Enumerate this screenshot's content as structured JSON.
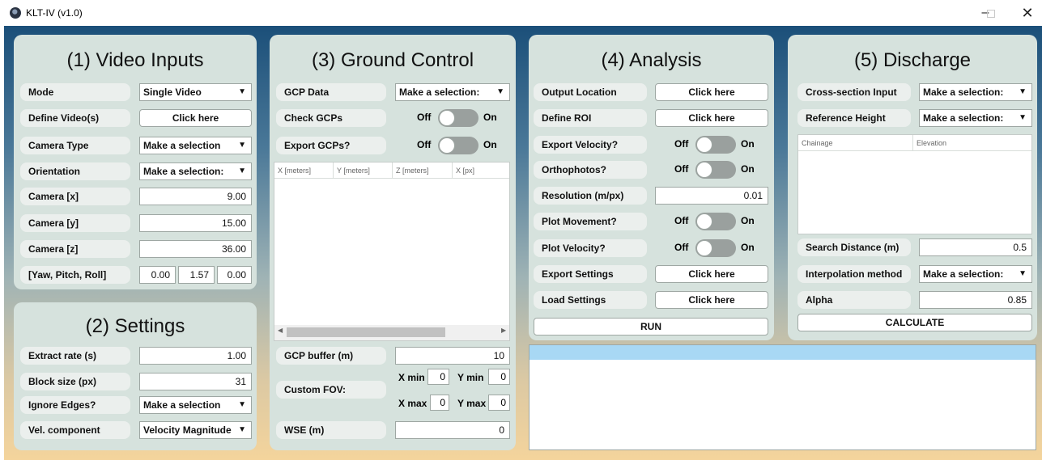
{
  "window": {
    "title": "KLT-IV (v1.0)",
    "min_glyph": "–",
    "close_glyph": "✕"
  },
  "colors": {
    "panel": "#d6e2dd",
    "label_bg": "#ebefed",
    "log_header": "#a8d8f4"
  },
  "video": {
    "title": "(1) Video Inputs",
    "mode_label": "Mode",
    "mode_value": "Single Video",
    "define_label": "Define Video(s)",
    "define_button": "Click here",
    "camera_type_label": "Camera Type",
    "camera_type_value": "Make a selection",
    "orientation_label": "Orientation",
    "orientation_value": "Make a selection:",
    "cam_x_label": "Camera [x]",
    "cam_x_value": "9.00",
    "cam_y_label": "Camera [y]",
    "cam_y_value": "15.00",
    "cam_z_label": "Camera [z]",
    "cam_z_value": "36.00",
    "ypr_label": "[Yaw, Pitch, Roll]",
    "yaw": "0.00",
    "pitch": "1.57",
    "roll": "0.00"
  },
  "settings": {
    "title": "(2) Settings",
    "extract_label": "Extract rate (s)",
    "extract_value": "1.00",
    "block_label": "Block size (px)",
    "block_value": "31",
    "edges_label": "Ignore Edges?",
    "edges_value": "Make a selection",
    "vel_label": "Vel. component",
    "vel_value": "Velocity Magnitude"
  },
  "ground": {
    "title": "(3) Ground Control",
    "gcp_label": "GCP Data",
    "gcp_value": "Make a selection:",
    "check_label": "Check GCPs",
    "export_label": "Export GCPs?",
    "table_cols": [
      "X [meters]",
      "Y [meters]",
      "Z [meters]",
      "X [px]"
    ],
    "buffer_label": "GCP buffer (m)",
    "buffer_value": "10",
    "fov_label": "Custom FOV:",
    "xmin_label": "X min",
    "xmin_value": "0",
    "ymin_label": "Y min",
    "ymin_value": "0",
    "xmax_label": "X max",
    "xmax_value": "0",
    "ymax_label": "Y max",
    "ymax_value": "0",
    "wse_label": "WSE (m)",
    "wse_value": "0"
  },
  "toggle": {
    "off": "Off",
    "on": "On"
  },
  "analysis": {
    "title": "(4) Analysis",
    "output_label": "Output Location",
    "output_button": "Click here",
    "roi_label": "Define ROI",
    "roi_button": "Click here",
    "export_vel_label": "Export Velocity?",
    "ortho_label": "Orthophotos?",
    "res_label": "Resolution (m/px)",
    "res_value": "0.01",
    "plot_move_label": "Plot Movement?",
    "plot_vel_label": "Plot Velocity?",
    "export_settings_label": "Export Settings",
    "export_settings_button": "Click here",
    "load_settings_label": "Load Settings",
    "load_settings_button": "Click here",
    "run_button": "RUN"
  },
  "discharge": {
    "title": "(5) Discharge",
    "cross_label": "Cross-section Input",
    "cross_value": "Make a selection:",
    "ref_label": "Reference Height",
    "ref_value": "Make a selection:",
    "table_cols": [
      "Chainage",
      "Elevation"
    ],
    "search_label": "Search Distance (m)",
    "search_value": "0.5",
    "interp_label": "Interpolation method",
    "interp_value": "Make a selection:",
    "alpha_label": "Alpha",
    "alpha_value": "0.85",
    "calc_button": "CALCULATE"
  }
}
